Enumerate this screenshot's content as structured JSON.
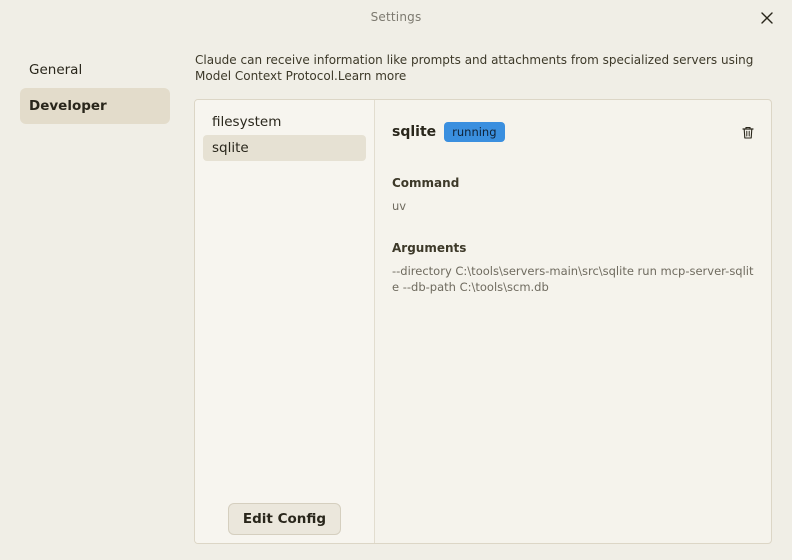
{
  "window": {
    "title": "Settings"
  },
  "nav": {
    "items": [
      {
        "label": "General",
        "active": false
      },
      {
        "label": "Developer",
        "active": true
      }
    ]
  },
  "intro": {
    "text": "Claude can receive information like prompts and attachments from specialized servers using Model Context Protocol.",
    "link": "Learn more"
  },
  "servers": {
    "items": [
      {
        "label": "filesystem",
        "active": false
      },
      {
        "label": "sqlite",
        "active": true
      }
    ],
    "edit_config_label": "Edit Config"
  },
  "detail": {
    "name": "sqlite",
    "status": "running",
    "command_label": "Command",
    "command_value": "uv",
    "arguments_label": "Arguments",
    "arguments_value": "--directory C:\\tools\\servers-main\\src\\sqlite run mcp-server-sqlite --db-path C:\\tools\\scm.db"
  },
  "icons": {
    "close": "close-icon",
    "delete": "trash-icon"
  },
  "colors": {
    "background": "#f0eee6",
    "nav_active": "#e3dccb",
    "badge_running": "#3a8fdf"
  }
}
